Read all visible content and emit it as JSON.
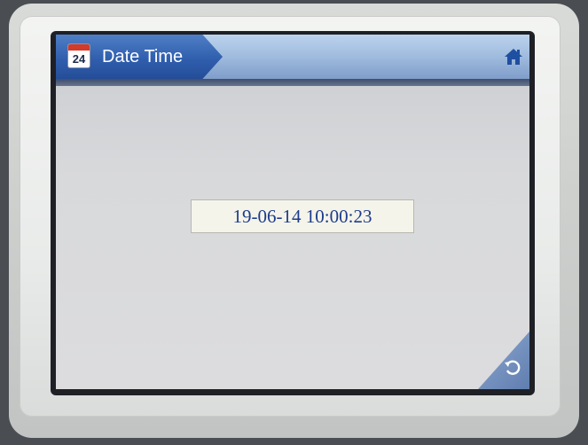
{
  "header": {
    "title": "Date Time",
    "calendar_icon": {
      "name": "calendar-icon",
      "day": "24"
    },
    "home_icon": "home-icon"
  },
  "main": {
    "datetime_value": "19-06-14 10:00:23"
  },
  "footer": {
    "back_icon": "back-icon"
  },
  "colors": {
    "title_tab": "#305fae",
    "title_bar": "#9cb8dc",
    "datetime_text": "#1c3b8c",
    "field_bg": "#f5f4ea"
  }
}
